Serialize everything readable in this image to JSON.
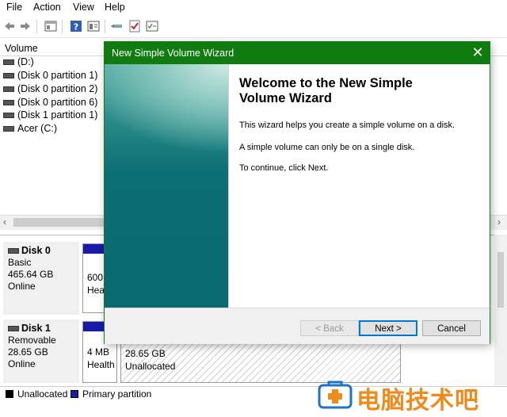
{
  "menu": [
    "File",
    "Action",
    "View",
    "Help"
  ],
  "volume_list": {
    "header": "Volume",
    "rows": [
      "(D:)",
      "(Disk 0 partition 1)",
      "(Disk 0 partition 2)",
      "(Disk 0 partition 6)",
      "(Disk 1 partition 1)",
      "Acer (C:)"
    ]
  },
  "disks": [
    {
      "name": "Disk 0",
      "type": "Basic",
      "size": "465.64 GB",
      "status": "Online",
      "partitions": [
        {
          "size": "600",
          "status": "Hea"
        }
      ]
    },
    {
      "name": "Disk 1",
      "type": "Removable",
      "size": "28.65 GB",
      "status": "Online",
      "partitions": [
        {
          "size": "4 MB",
          "status": "Health"
        },
        {
          "size": "28.65 GB",
          "status": "Unallocated"
        }
      ]
    }
  ],
  "legend": [
    {
      "label": "Unallocated",
      "color": "#000000"
    },
    {
      "label": "Primary partition",
      "color": "#1a1aa8"
    }
  ],
  "wizard": {
    "title": "New Simple Volume Wizard",
    "close_icon": "close-icon",
    "heading_line1": "Welcome to the New Simple",
    "heading_line2": "Volume Wizard",
    "para1": "This wizard helps you create a simple volume on a disk.",
    "para2": "A simple volume can only be on a single disk.",
    "para3": "To continue, click Next.",
    "back_label": "< Back",
    "next_label": "Next >",
    "cancel_label": "Cancel",
    "accent": "#107c10"
  },
  "watermark": {
    "text": "电脑技术吧"
  }
}
